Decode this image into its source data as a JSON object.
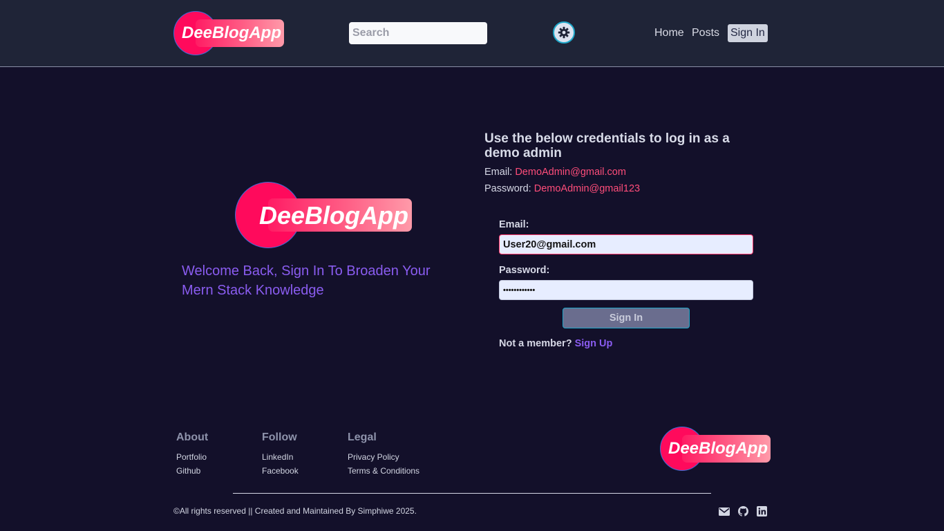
{
  "brand": {
    "name": "DeeBlogApp"
  },
  "header": {
    "search_placeholder": "Search",
    "nav": [
      "Home",
      "Posts",
      "Sign In"
    ]
  },
  "hero": {
    "welcome": "Welcome Back, Sign In To Broaden Your Mern Stack Knowledge"
  },
  "credentials": {
    "title": "Use the below credentials to log in as a demo admin",
    "email_label": "Email:",
    "email_value": "DemoAdmin@gmail.com",
    "password_label": "Password:",
    "password_value": "DemoAdmin@gmail123"
  },
  "form": {
    "email_label": "Email:",
    "email_value": "User20@gmail.com",
    "password_label": "Password:",
    "password_value": "••••••••••••",
    "submit_label": "Sign In",
    "not_member": "Not a member?",
    "signup_link": "Sign Up"
  },
  "footer": {
    "columns": [
      {
        "heading": "About",
        "links": [
          "Portfolio",
          "Github"
        ]
      },
      {
        "heading": "Follow",
        "links": [
          "LinkedIn",
          "Facebook"
        ]
      },
      {
        "heading": "Legal",
        "links": [
          "Privacy Policy",
          "Terms & Conditions"
        ]
      }
    ],
    "copyright": "©All rights reserved || Created and Maintained By Simphiwe 2025.",
    "icons": [
      "mail-icon",
      "github-icon",
      "linkedin-icon"
    ]
  },
  "colors": {
    "header_bg": "#1f2437",
    "page_bg": "#13102a",
    "brand_pink": "#ff0a5c",
    "accent_purple": "#8a5cf0",
    "credential_pink": "#ff4d7a"
  }
}
